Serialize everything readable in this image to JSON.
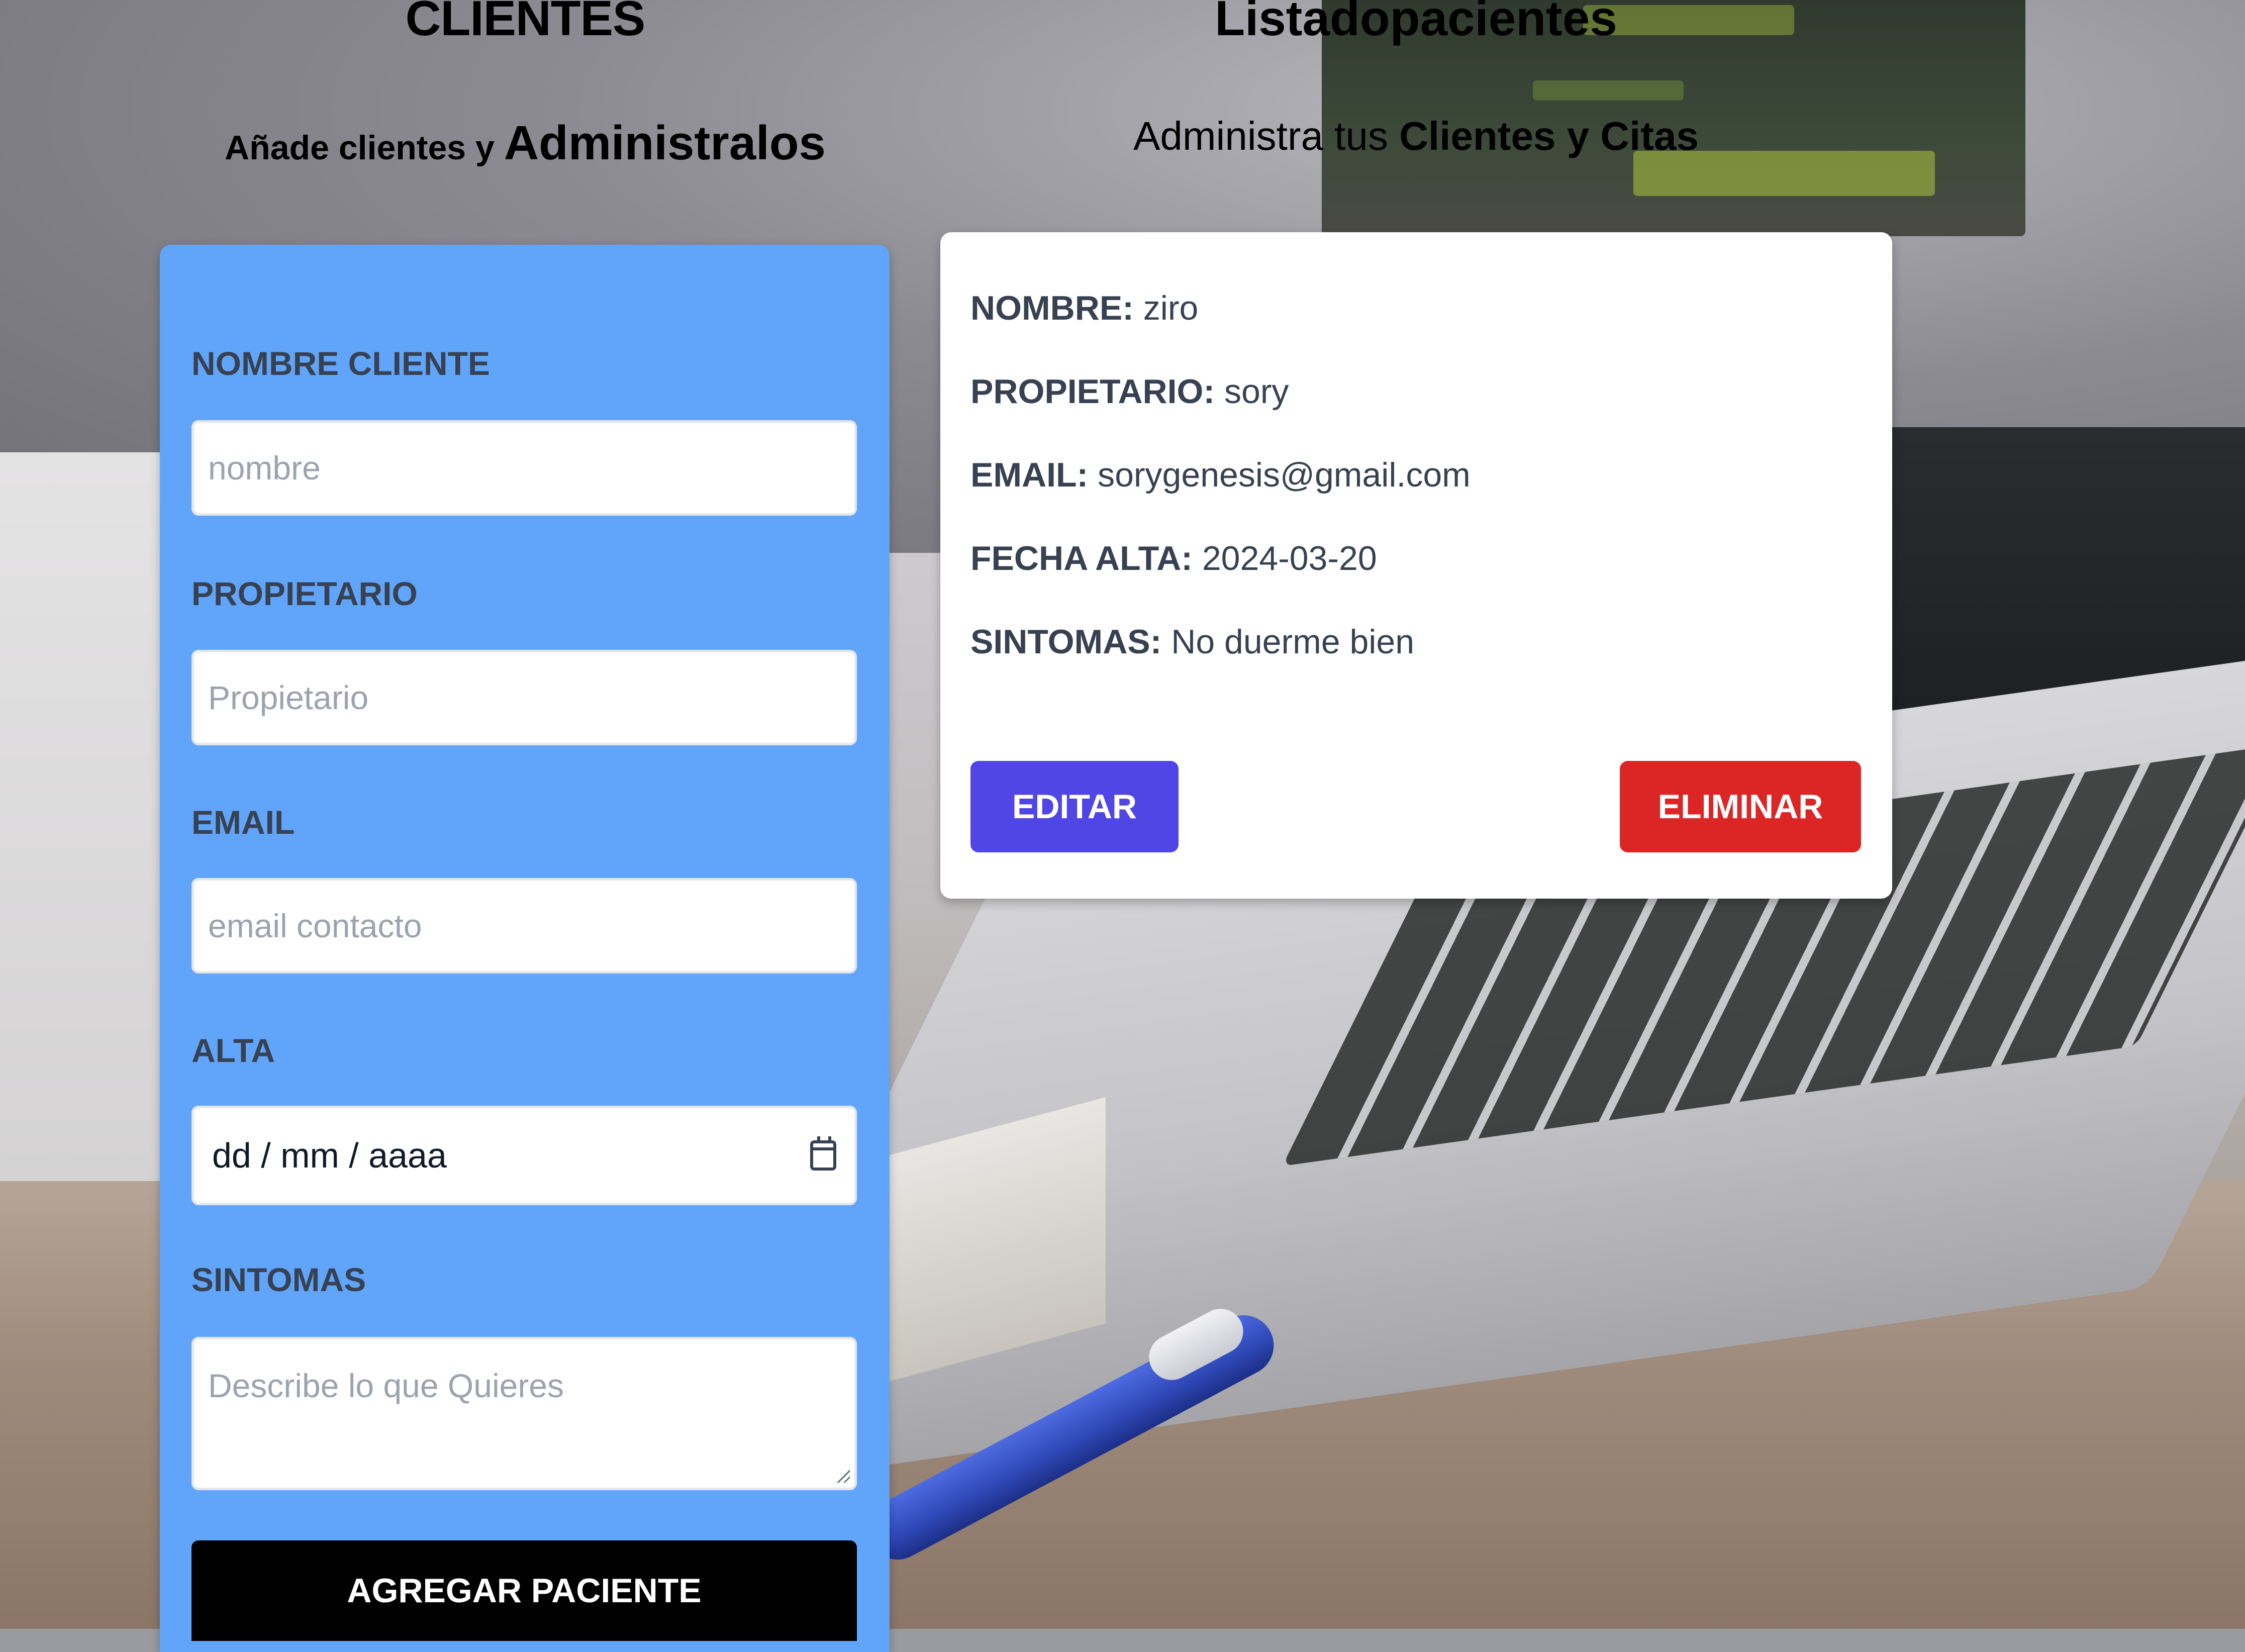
{
  "left_header": {
    "title": "CLIENTES",
    "subtitle_prefix": "Añade clientes y",
    "subtitle_accent": "Administralos"
  },
  "right_header": {
    "title": "Listadopacientes",
    "subtitle_prefix": "Administra tus",
    "subtitle_accent": "Clientes y Citas"
  },
  "form": {
    "fields": [
      {
        "label": "NOMBRE CLIENTE",
        "placeholder": "nombre",
        "value": ""
      },
      {
        "label": "PROPIETARIO",
        "placeholder": "Propietario",
        "value": ""
      },
      {
        "label": "EMAIL",
        "placeholder": "email contacto",
        "value": ""
      },
      {
        "label": "ALTA",
        "display": "dd / mm / aaaa"
      },
      {
        "label": "SINTOMAS",
        "placeholder": "Describe lo que Quieres",
        "value": ""
      }
    ],
    "submit_label": "AGREGAR PACIENTE"
  },
  "patient": {
    "rows": [
      {
        "key": "NOMBRE:",
        "value": "ziro"
      },
      {
        "key": "PROPIETARIO:",
        "value": "sory"
      },
      {
        "key": "EMAIL:",
        "value": "sorygenesis@gmail.com"
      },
      {
        "key": "FECHA ALTA:",
        "value": "2024-03-20"
      },
      {
        "key": "SINTOMAS:",
        "value": "No duerme bien"
      }
    ],
    "edit_label": "EDITAR",
    "delete_label": "ELIMINAR"
  },
  "colors": {
    "form_panel": "#60a5fa",
    "edit_button": "#4f46e5",
    "delete_button": "#dc2626",
    "submit_button": "#000000"
  },
  "icons": {
    "date_picker": "calendar-icon"
  }
}
